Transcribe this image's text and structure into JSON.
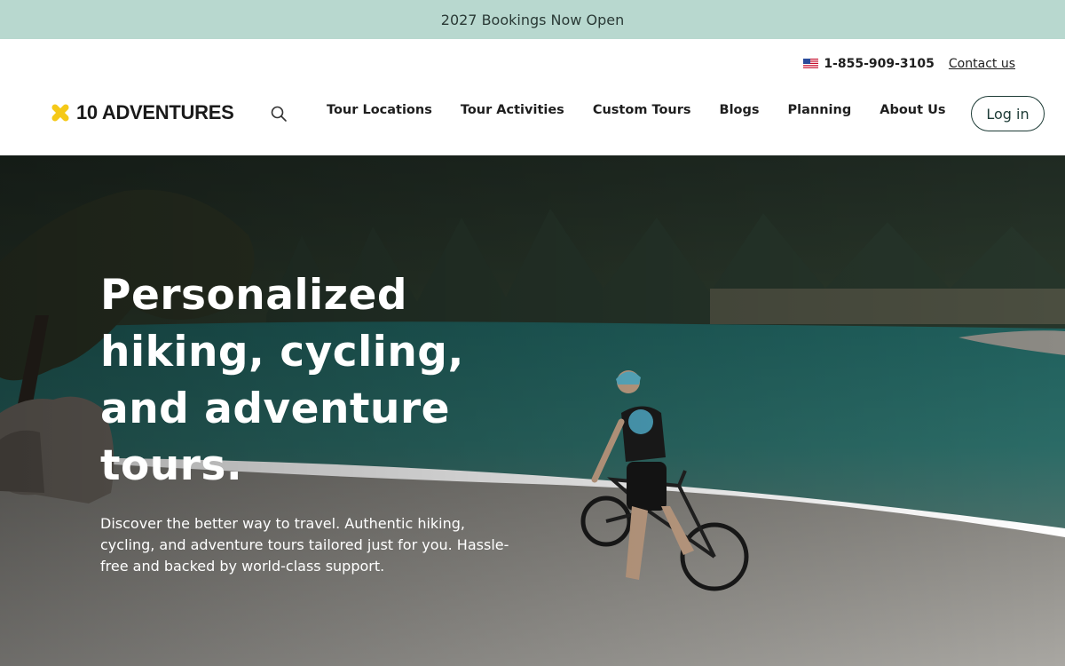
{
  "announcement": {
    "text": "2027 Bookings Now Open"
  },
  "header": {
    "phone": "1-855-909-3105",
    "contact_label": "Contact us",
    "logo_text": "10 ADVENTURES",
    "nav": [
      {
        "label": "Tour Locations"
      },
      {
        "label": "Tour Activities"
      },
      {
        "label": "Custom Tours"
      },
      {
        "label": "Blogs"
      },
      {
        "label": "Planning"
      },
      {
        "label": "About Us"
      }
    ],
    "login_label": "Log in"
  },
  "hero": {
    "title": "Personalized hiking, cycling, and adventure tours.",
    "subtitle": "Discover the better way to travel. Authentic hiking, cycling, and adventure tours tailored just for you. Hassle-free and backed by world-class support."
  },
  "colors": {
    "announce_bg": "#b8d8cf",
    "logo_accent": "#f5c918",
    "button_border": "#1d3b36"
  },
  "icons": {
    "logo_mark": "x-mark-icon",
    "search": "search-icon",
    "flag": "us-flag-icon"
  }
}
